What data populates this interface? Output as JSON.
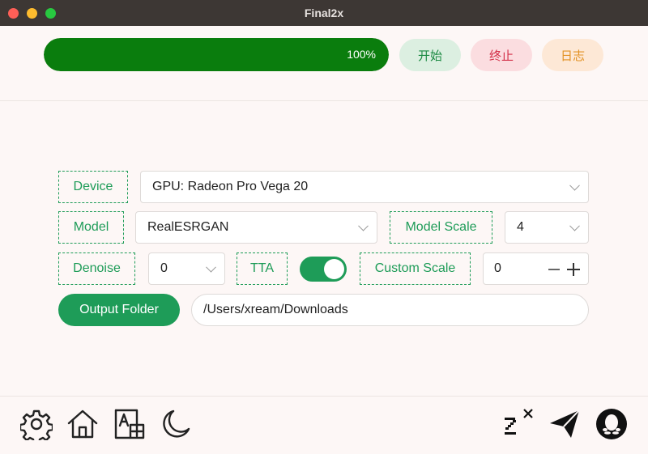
{
  "window": {
    "title": "Final2x"
  },
  "toolbar": {
    "progress_value": 1.0,
    "progress_label": "100%",
    "start_label": "开始",
    "stop_label": "终止",
    "log_label": "日志"
  },
  "settings": {
    "device": {
      "label": "Device",
      "value": "GPU: Radeon Pro Vega 20"
    },
    "model": {
      "label": "Model",
      "value": "RealESRGAN"
    },
    "model_scale": {
      "label": "Model Scale",
      "value": "4"
    },
    "denoise": {
      "label": "Denoise",
      "value": "0"
    },
    "tta": {
      "label": "TTA",
      "enabled": true
    },
    "custom_scale": {
      "label": "Custom Scale",
      "value": "0"
    },
    "output": {
      "button_label": "Output Folder",
      "path": "/Users/xream/Downloads"
    }
  },
  "footer": {
    "left_icons": [
      "gear-icon",
      "home-icon",
      "translate-icon",
      "moon-icon"
    ],
    "right_icons": [
      "final2x-logo-icon",
      "paper-plane-icon",
      "qq-penguin-icon"
    ]
  },
  "colors": {
    "accent": "#1e9c58",
    "progress": "#0a7d0d",
    "stop": "#d33049",
    "log": "#e39224",
    "titlebar": "#3d3734"
  }
}
